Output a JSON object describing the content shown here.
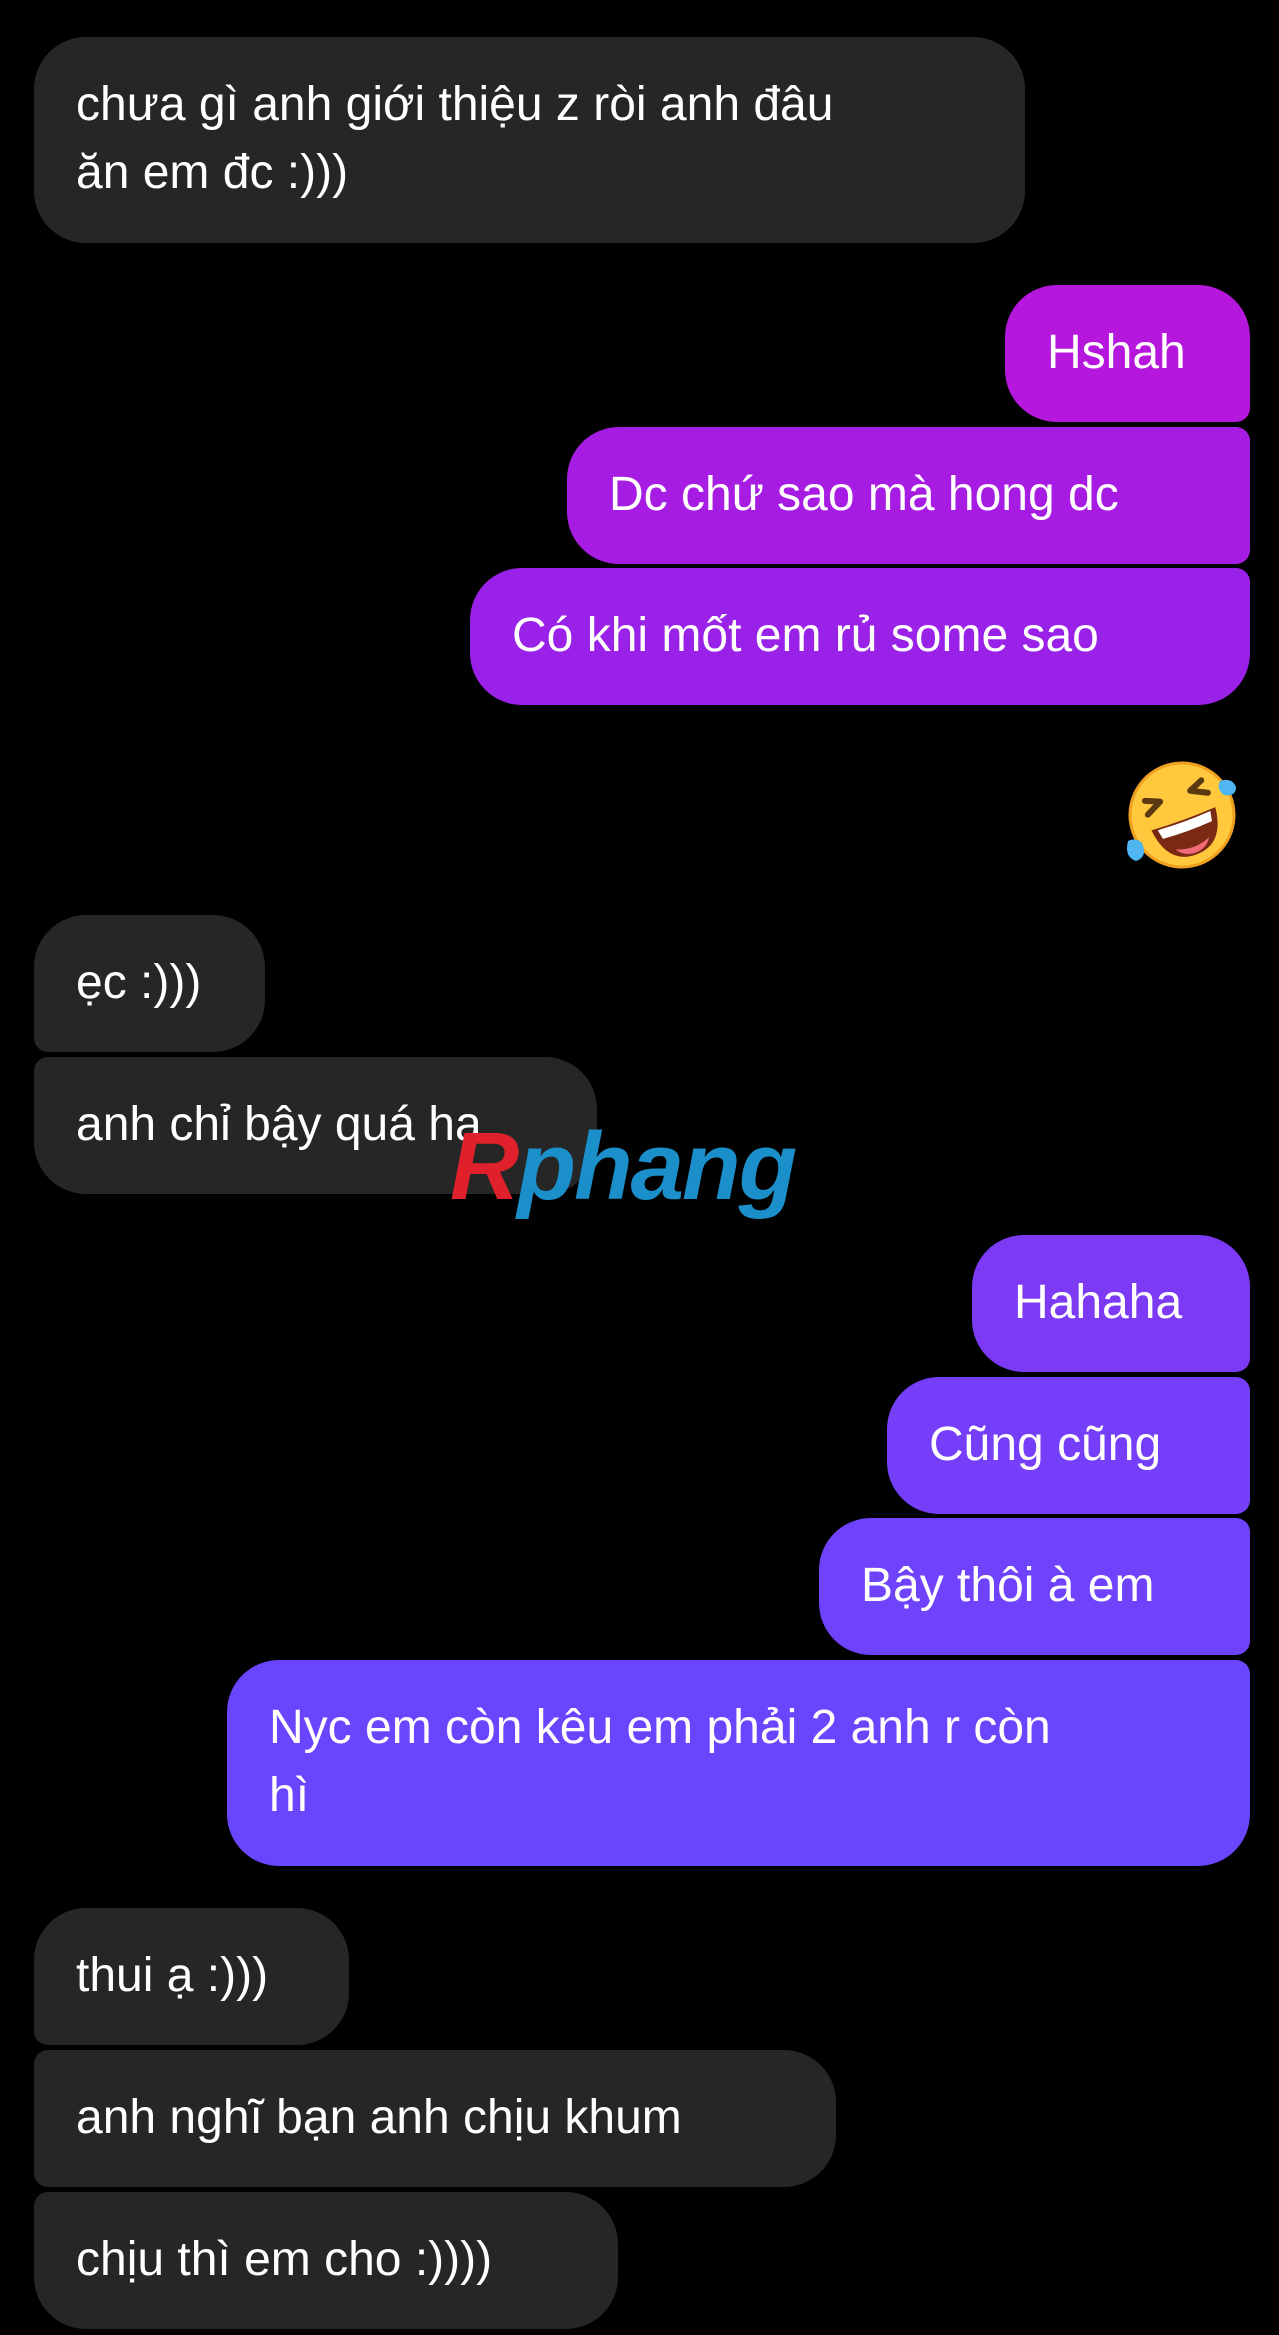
{
  "colors": {
    "background": "#000000",
    "incoming_bubble": "#262626",
    "outgoing_bubble_top": "#B517DC",
    "outgoing_bubble_bottom": "#6A45FE",
    "text": "#FFFFFF"
  },
  "messages": [
    {
      "direction": "incoming",
      "text": "chưa gì anh giới thiệu z ròi anh đâu",
      "text_line2": "ăn em đc :)))"
    },
    {
      "direction": "outgoing",
      "text": "Hshah"
    },
    {
      "direction": "outgoing",
      "text": "Dc chứ sao mà hong dc"
    },
    {
      "direction": "outgoing",
      "text": "Có khi mốt em rủ some sao"
    },
    {
      "direction": "outgoing",
      "type": "emoji",
      "emoji": "rolling-on-floor-laughing-icon"
    },
    {
      "direction": "incoming",
      "text": "ẹc :)))"
    },
    {
      "direction": "incoming",
      "text": "anh chỉ bậy quá ha"
    },
    {
      "direction": "outgoing",
      "text": "Hahaha"
    },
    {
      "direction": "outgoing",
      "text": "Cũng cũng"
    },
    {
      "direction": "outgoing",
      "text": "Bậy thôi à em"
    },
    {
      "direction": "outgoing",
      "text": "Nyc em còn kêu em phải 2 anh r còn",
      "text_line2": "hì"
    },
    {
      "direction": "incoming",
      "text": "thui ạ :)))"
    },
    {
      "direction": "incoming",
      "text": "anh nghĩ bạn anh chịu khum"
    },
    {
      "direction": "incoming",
      "text": "chịu thì em cho :))))"
    }
  ],
  "watermark": {
    "text_part1": "R",
    "text_part2": "phang",
    "color1": "#E0202A",
    "color2": "#1A8FC9"
  }
}
